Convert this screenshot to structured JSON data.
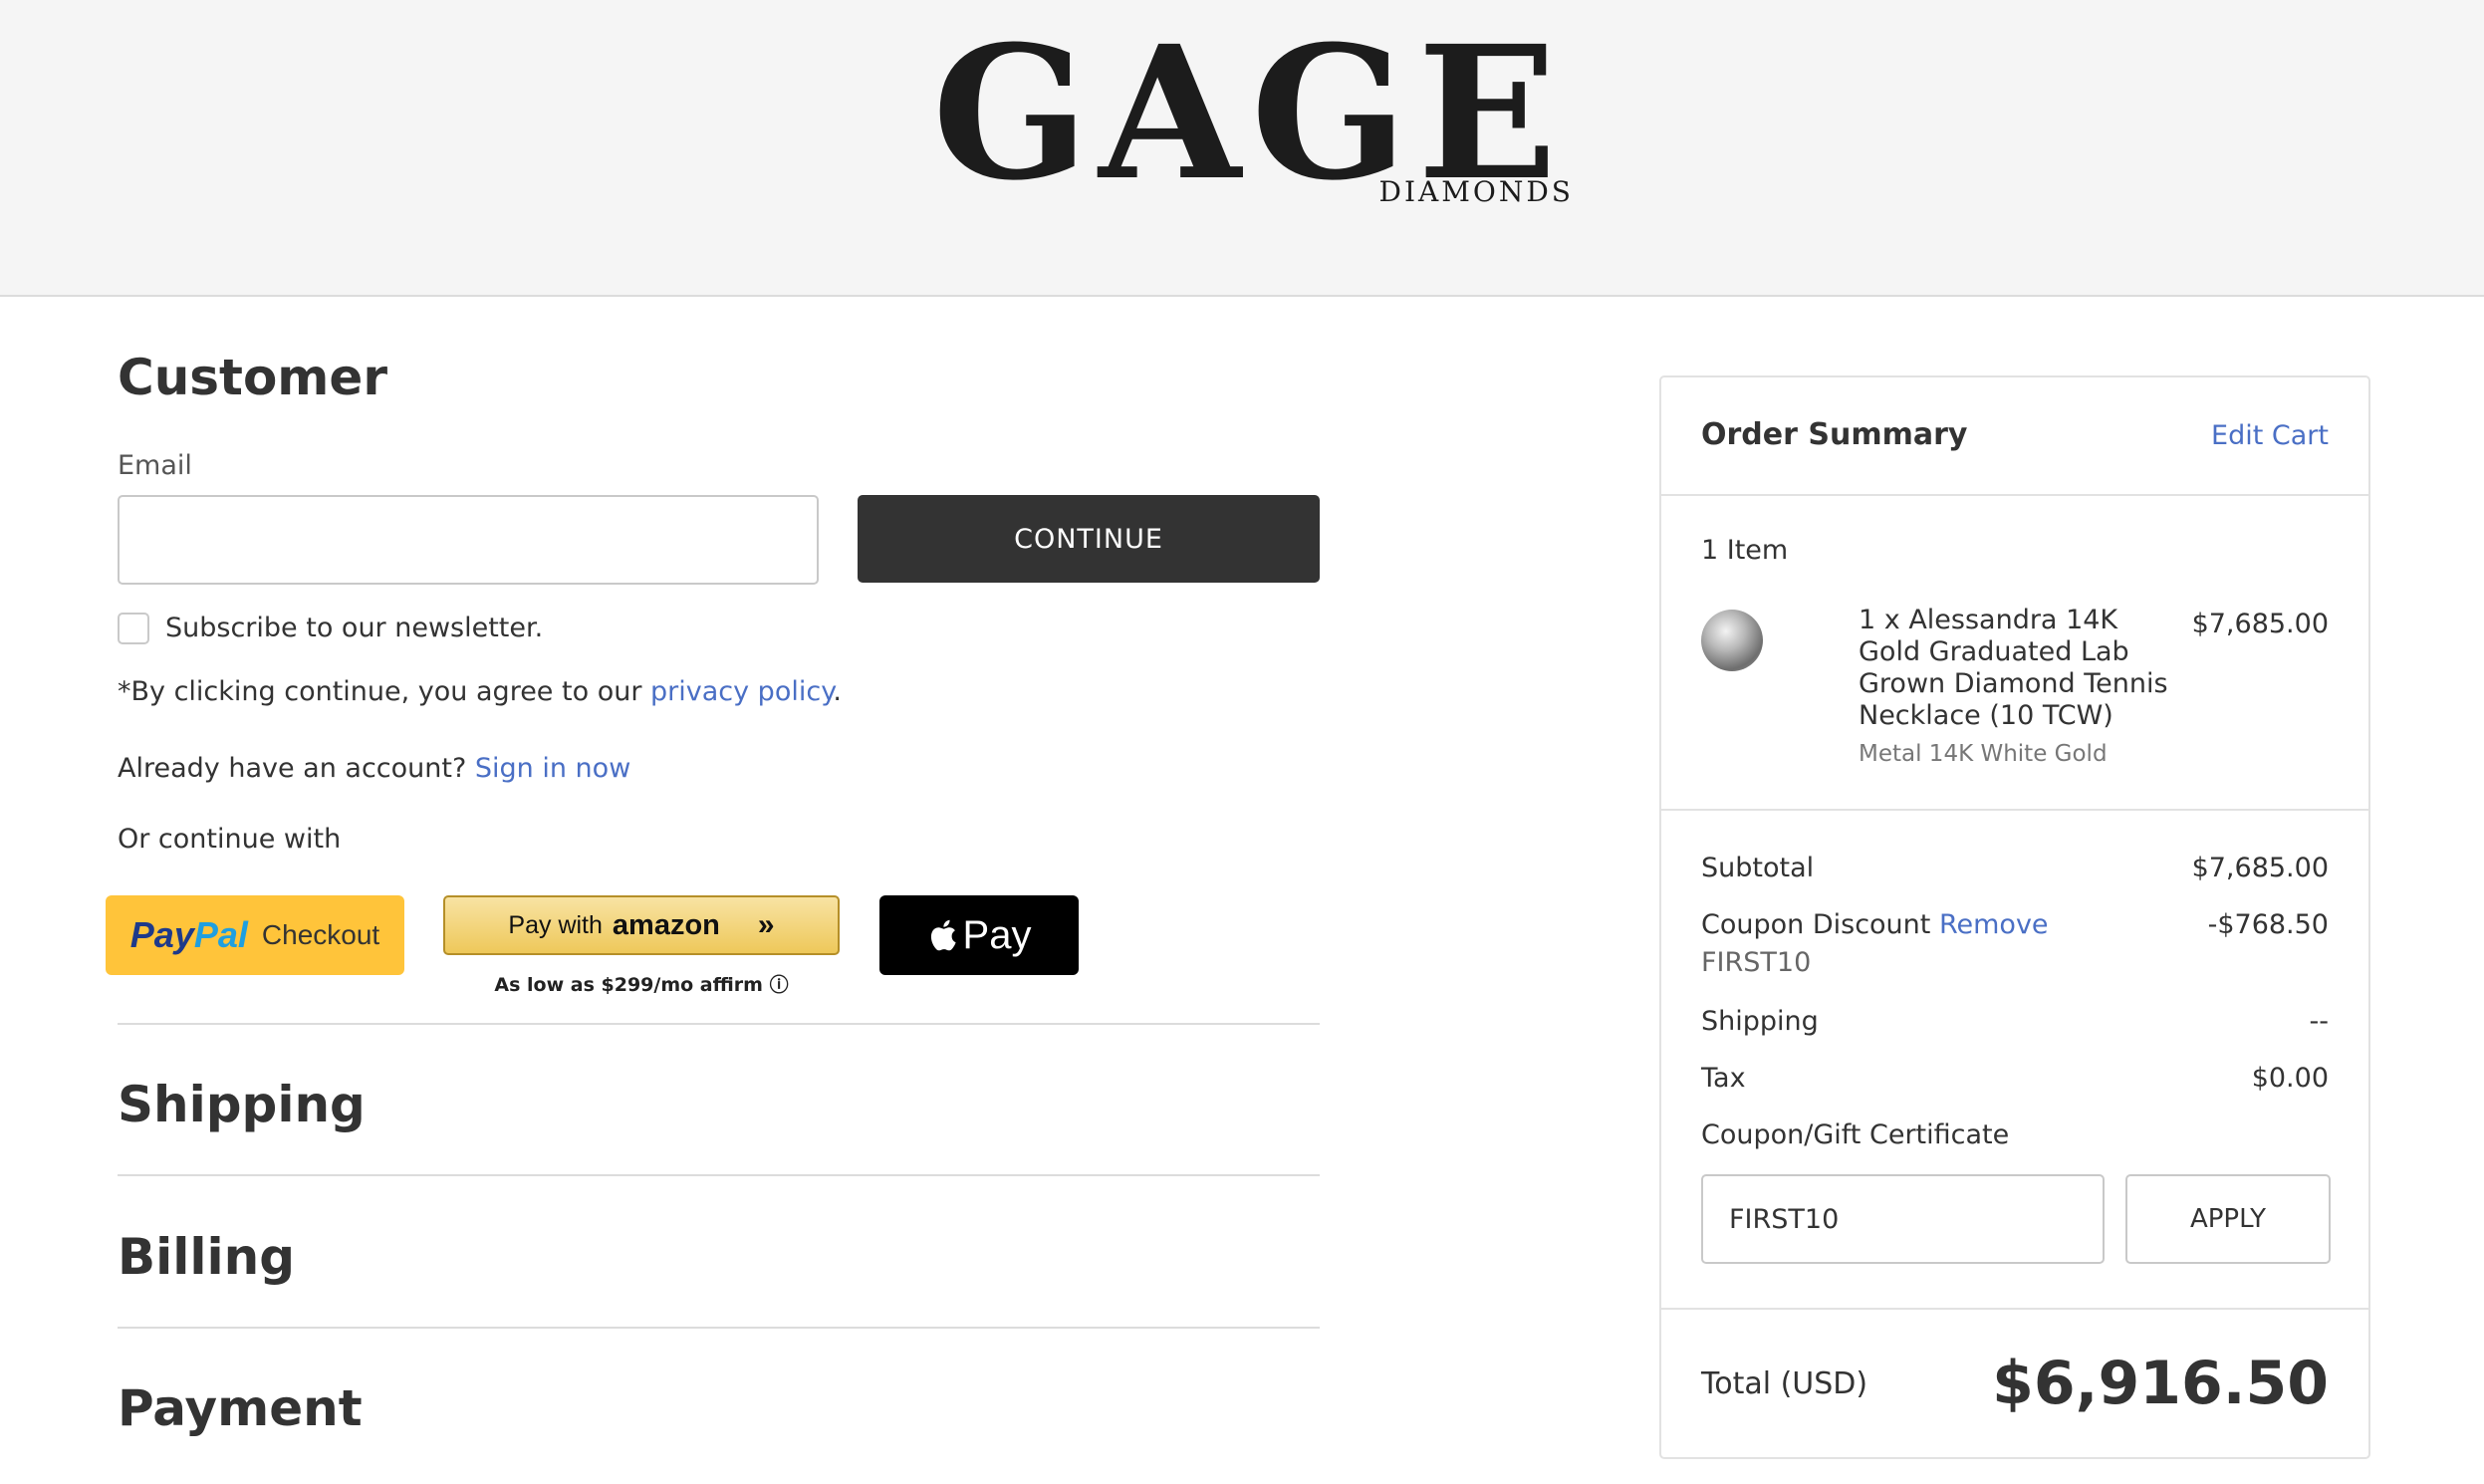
{
  "header": {
    "logo_main": "GAGE",
    "logo_sub": "DIAMONDS"
  },
  "customer": {
    "title": "Customer",
    "email_label": "Email",
    "email_value": "",
    "continue_label": "CONTINUE",
    "newsletter_label": "Subscribe to our newsletter.",
    "agree_prefix": "*By clicking continue, you agree to our ",
    "privacy_link": "privacy policy",
    "agree_suffix": ".",
    "account_prefix": "Already have an account? ",
    "sign_in_link": "Sign in now",
    "continue_with": "Or continue with"
  },
  "payment_buttons": {
    "paypal_pay": "Pay",
    "paypal_pal": "Pal",
    "paypal_checkout": "Checkout",
    "amazon_prefix": "Pay with",
    "amazon_word": "amazon",
    "amazon_chevron": "»",
    "affirm_text": "As low as $299/mo affirm ⓘ",
    "applepay_text": "Pay"
  },
  "sections": {
    "shipping": "Shipping",
    "billing": "Billing",
    "payment": "Payment"
  },
  "summary": {
    "title": "Order Summary",
    "edit_cart": "Edit Cart",
    "item_count": "1 Item",
    "item_name": "1 x Alessandra 14K Gold Graduated Lab Grown Diamond Tennis Necklace (10 TCW)",
    "item_price": "$7,685.00",
    "item_option": "Metal 14K White Gold",
    "subtotal_label": "Subtotal",
    "subtotal_value": "$7,685.00",
    "coupon_label": "Coupon Discount",
    "coupon_remove": "Remove",
    "coupon_code": "FIRST10",
    "coupon_value": "-$768.50",
    "shipping_label": "Shipping",
    "shipping_value": "--",
    "tax_label": "Tax",
    "tax_value": "$0.00",
    "coupon_link": "Coupon/Gift Certificate",
    "coupon_input_value": "FIRST10",
    "apply_label": "APPLY",
    "total_label": "Total (USD)",
    "total_value": "$6,916.50"
  },
  "icons": {
    "checkbox": "checkbox-empty",
    "apple": "apple-logo-icon",
    "amazon_arrow": "double-chevron-right-icon",
    "product_thumb": "diamond-thumbnail"
  }
}
